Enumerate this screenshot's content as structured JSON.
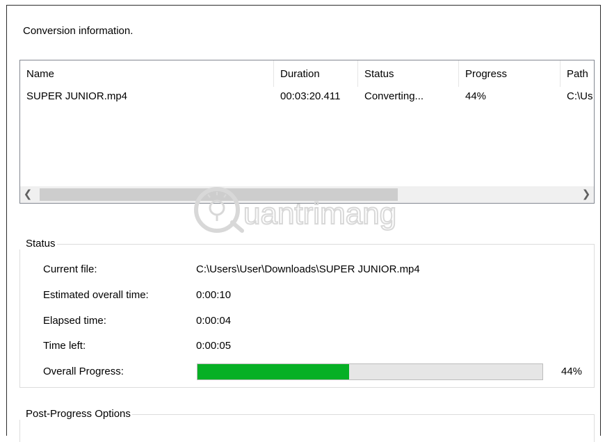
{
  "title": "Conversion information.",
  "list": {
    "columns": [
      "Name",
      "Duration",
      "Status",
      "Progress",
      "Path"
    ],
    "rows": [
      {
        "name": "SUPER JUNIOR.mp4",
        "duration": "00:03:20.411",
        "status": "Converting...",
        "progress": "44%",
        "path": "C:\\Us"
      }
    ],
    "scroll_left_icon": "chevron-left",
    "scroll_right_icon": "chevron-right"
  },
  "status_group": {
    "label": "Status",
    "current_file_label": "Current file:",
    "current_file_value": "C:\\Users\\User\\Downloads\\SUPER JUNIOR.mp4",
    "estimated_label": "Estimated overall time:",
    "estimated_value": "0:00:10",
    "elapsed_label": "Elapsed time:",
    "elapsed_value": "0:00:04",
    "time_left_label": "Time left:",
    "time_left_value": "0:00:05",
    "overall_label": "Overall Progress:",
    "overall_percent": "44%",
    "overall_fraction": 0.44,
    "progress_color": "#06b025"
  },
  "post_group": {
    "label": "Post-Progress Options"
  },
  "watermark": {
    "text": "uantrimang"
  }
}
